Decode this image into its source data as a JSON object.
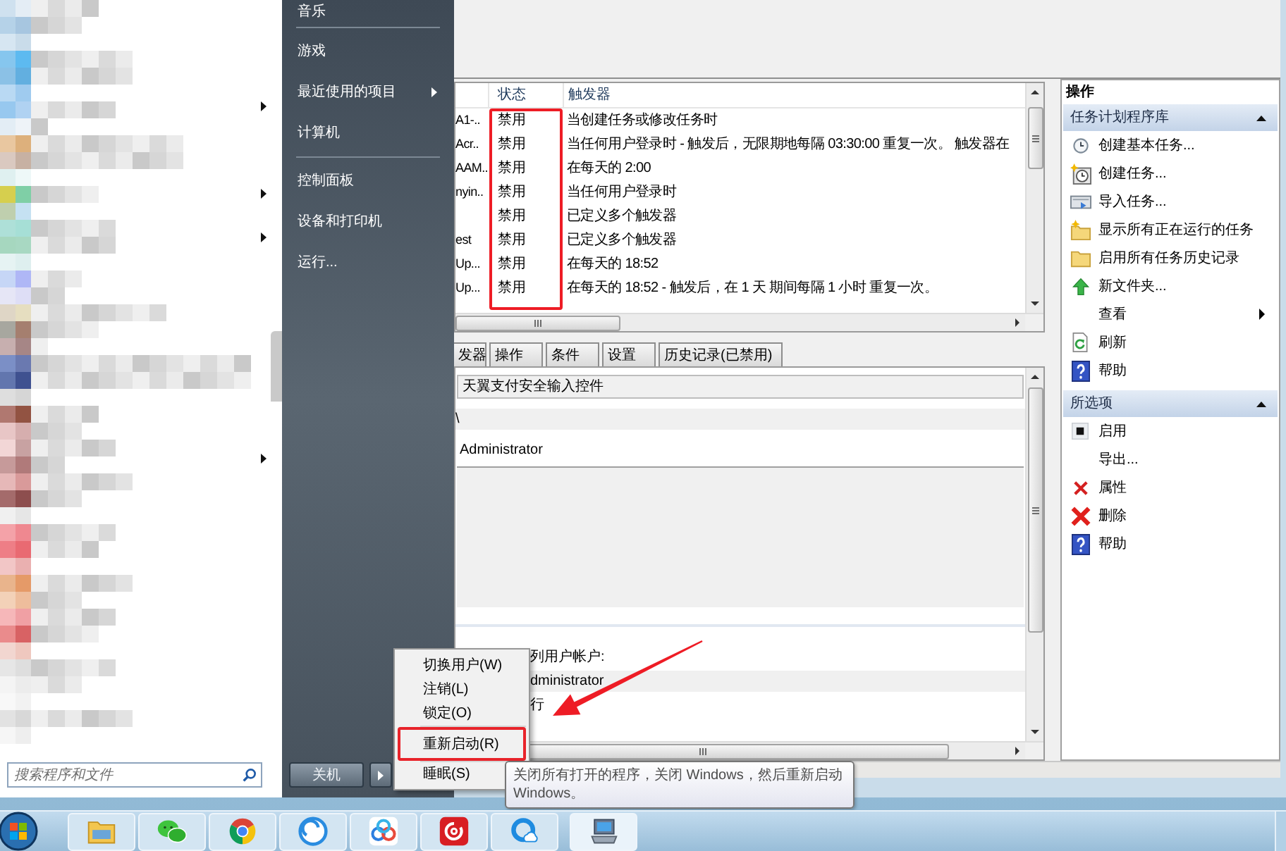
{
  "start_menu": {
    "place_groups": [
      {
        "items": [
          {
            "label": "音乐",
            "submenu": false
          }
        ]
      },
      {
        "items": [
          {
            "label": "游戏",
            "submenu": false
          },
          {
            "label": "最近使用的项目",
            "submenu": true
          },
          {
            "label": "计算机",
            "submenu": false
          }
        ]
      },
      {
        "items": [
          {
            "label": "控制面板",
            "submenu": false
          },
          {
            "label": "设备和打印机",
            "submenu": false
          },
          {
            "label": "运行...",
            "submenu": false
          }
        ]
      }
    ],
    "search": {
      "placeholder": "搜索程序和文件"
    },
    "shutdown_button": "关机"
  },
  "task_list": {
    "columns": [
      {
        "label": "状态",
        "marked": true
      },
      {
        "label": "触发器",
        "marked": false
      }
    ],
    "rows": [
      {
        "name": "A1-..",
        "status": "禁用",
        "trigger": "当创建任务或修改任务时"
      },
      {
        "name": "Acr..",
        "status": "禁用",
        "trigger": "当任何用户登录时 - 触发后，无限期地每隔 03:30:00 重复一次。 触发器在"
      },
      {
        "name": "AAM..",
        "status": "禁用",
        "trigger": "在每天的 2:00"
      },
      {
        "name": "nyin..",
        "status": "禁用",
        "trigger": "当任何用户登录时"
      },
      {
        "status": "禁用",
        "trigger": "已定义多个触发器"
      },
      {
        "name": "est",
        "status": "禁用",
        "trigger": "已定义多个触发器"
      },
      {
        "name": "Up...",
        "status": "禁用",
        "trigger": "在每天的 18:52"
      },
      {
        "name": "Up...",
        "status": "禁用",
        "trigger": "在每天的 18:52 - 触发后，在 1 天 期间每隔 1 小时 重复一次。"
      }
    ]
  },
  "detail_tabs": [
    {
      "label": "发器",
      "selected": false
    },
    {
      "label": "操作",
      "selected": false
    },
    {
      "label": "条件",
      "selected": false
    },
    {
      "label": "设置",
      "selected": false
    },
    {
      "label": "历史记录(已禁用)",
      "selected": false
    }
  ],
  "general": {
    "name": "天翼支付安全输入控件",
    "location": "\\",
    "author": "Administrator",
    "security_label": "列用户帐户:",
    "user_account": "dministrator",
    "run_option": "行"
  },
  "actions_pane": {
    "title": "操作",
    "sections": [
      {
        "title": "任务计划程序库",
        "expanded": true,
        "items": [
          {
            "label": "创建基本任务...",
            "kind": "basic-task",
            "submenu": false
          },
          {
            "label": "创建任务...",
            "kind": "new-task",
            "submenu": false
          },
          {
            "label": "导入任务...",
            "kind": "import",
            "submenu": false
          },
          {
            "label": "显示所有正在运行的任务",
            "kind": "running",
            "submenu": false
          },
          {
            "label": "启用所有任务历史记录",
            "kind": "history",
            "submenu": false
          },
          {
            "label": "新文件夹...",
            "kind": "new-folder",
            "submenu": false
          },
          {
            "label": "查看",
            "kind": "view",
            "submenu": true
          },
          {
            "label": "刷新",
            "kind": "refresh",
            "submenu": false
          },
          {
            "label": "帮助",
            "kind": "help",
            "submenu": false
          }
        ]
      },
      {
        "title": "所选项",
        "expanded": true,
        "items": [
          {
            "label": "启用",
            "kind": "enable",
            "submenu": false
          },
          {
            "label": "导出...",
            "kind": "export",
            "submenu": false
          },
          {
            "label": "属性",
            "kind": "properties",
            "submenu": false
          },
          {
            "label": "删除",
            "kind": "delete",
            "submenu": false
          },
          {
            "label": "帮助",
            "kind": "help",
            "submenu": false
          }
        ]
      }
    ]
  },
  "power_menu": {
    "groups": [
      {
        "items": [
          {
            "label": "切换用户(W)",
            "marked": false
          },
          {
            "label": "注销(L)",
            "marked": false
          },
          {
            "label": "锁定(O)",
            "marked": false
          }
        ]
      },
      {
        "items": [
          {
            "label": "重新启动(R)",
            "marked": true
          }
        ]
      },
      {
        "items": [
          {
            "label": "睡眠(S)",
            "marked": false
          }
        ]
      }
    ]
  },
  "tooltip": "关闭所有打开的程序，关闭 Windows，然后重新启动 Windows。",
  "annotation_arrow": true
}
